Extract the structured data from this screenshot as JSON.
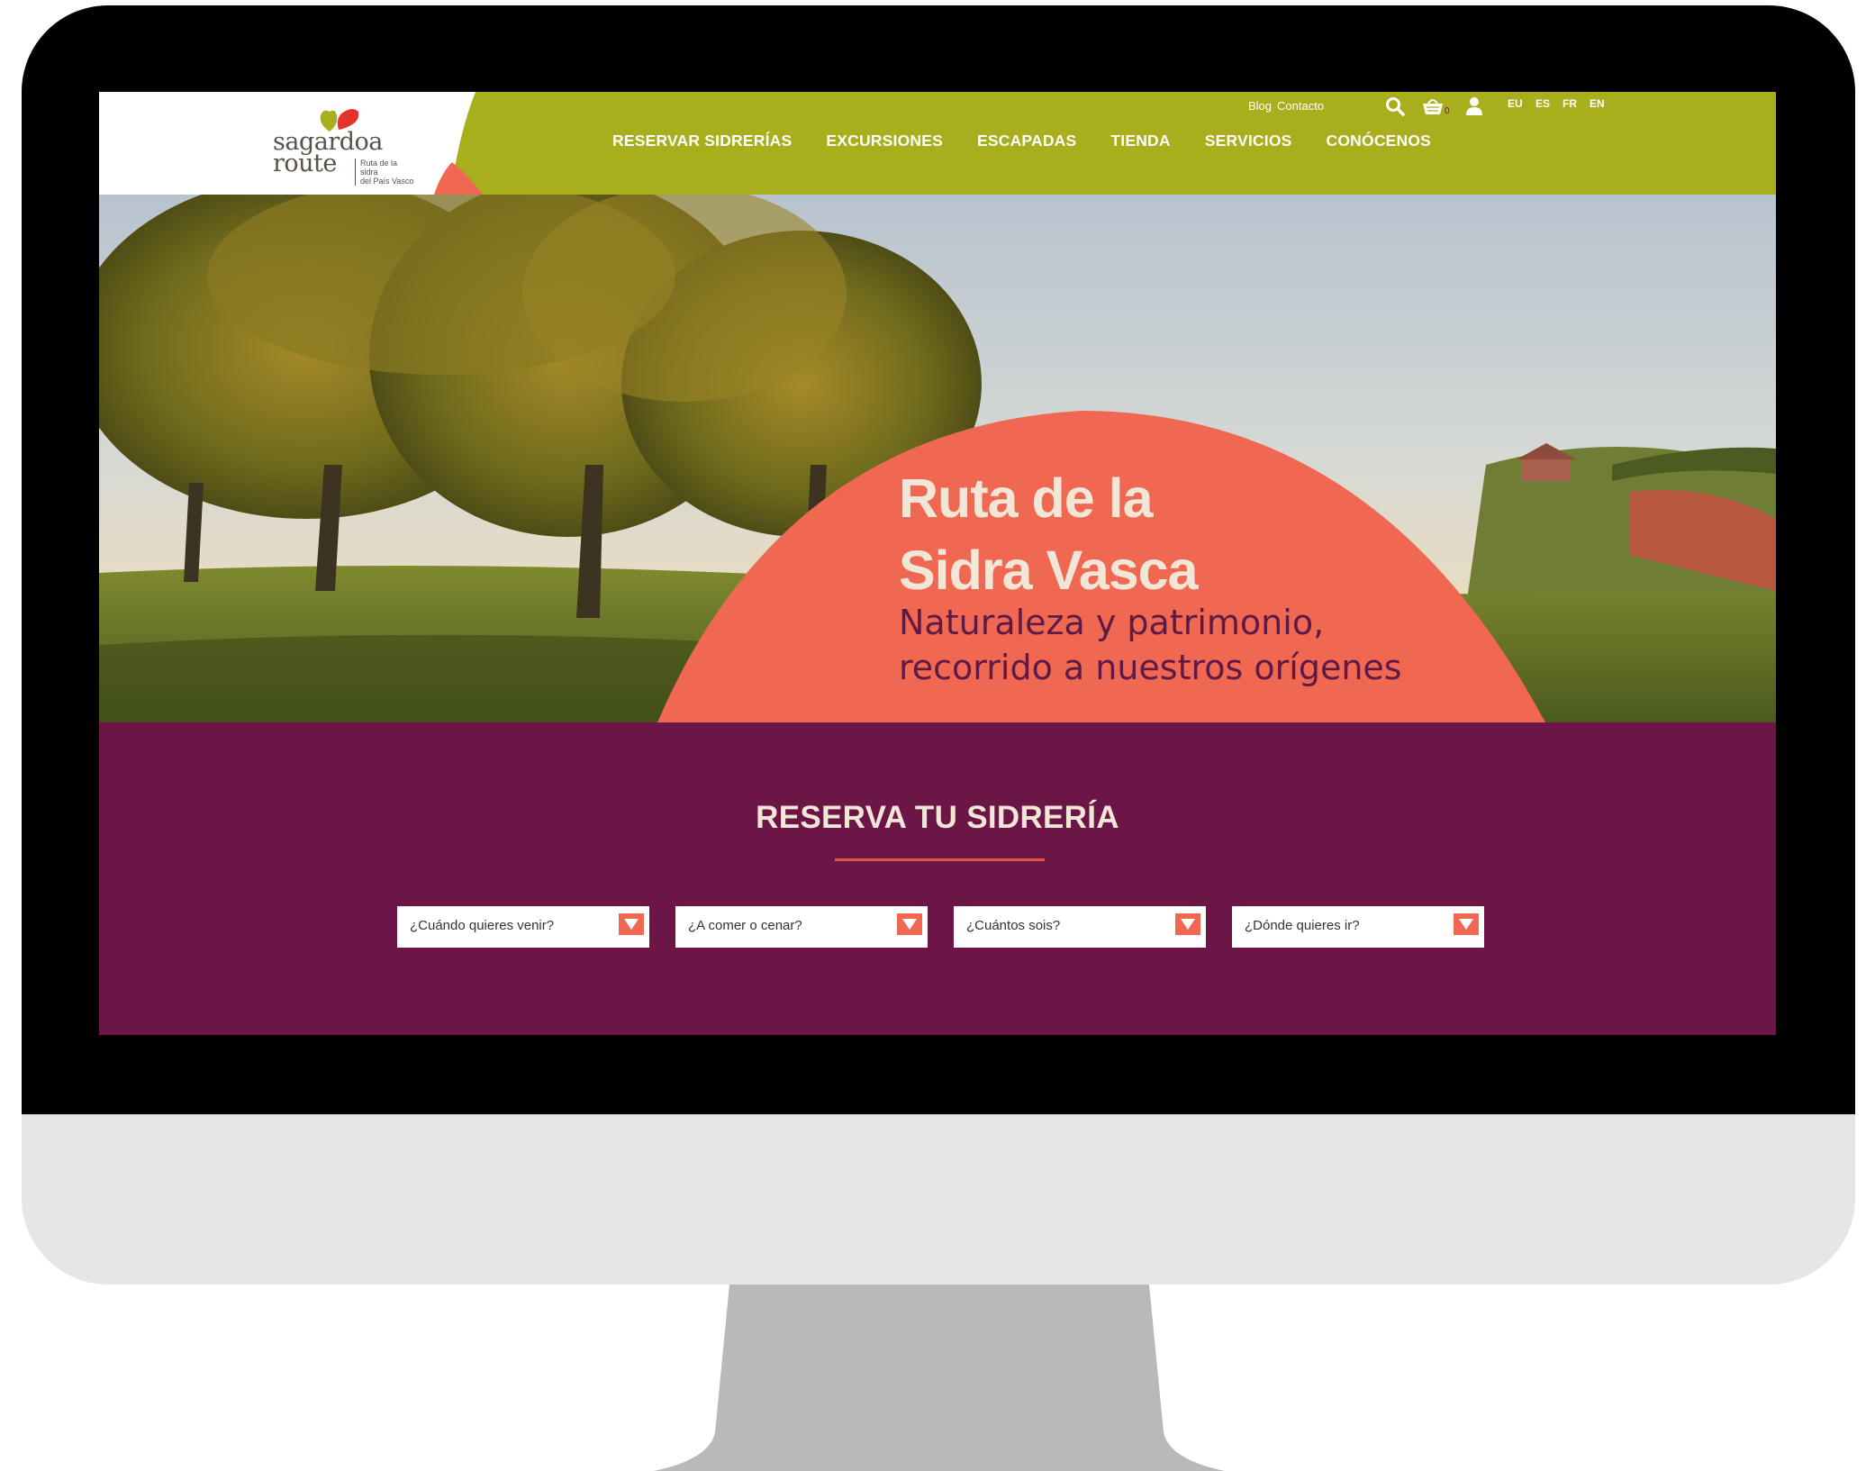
{
  "logo": {
    "line1": "sagardoa",
    "line2": "route",
    "tagline_1": "Ruta de la sidra",
    "tagline_2": "del País Vasco"
  },
  "top_links": [
    "Blog",
    "Contacto"
  ],
  "icons": {
    "search": "search-icon",
    "cart": "basket-icon",
    "user": "user-icon"
  },
  "cart_count": "0",
  "languages": [
    "EU",
    "ES",
    "FR",
    "EN"
  ],
  "nav": [
    "RESERVAR SIDRERÍAS",
    "EXCURSIONES",
    "ESCAPADAS",
    "TIENDA",
    "SERVICIOS",
    "CONÓCENOS"
  ],
  "hero": {
    "title_line1": "Ruta de la",
    "title_line2": "Sidra Vasca",
    "subtitle_line1": "Naturaleza y patrimonio,",
    "subtitle_line2": "recorrido a nuestros orígenes"
  },
  "booking": {
    "title": "RESERVA TU SIDRERÍA",
    "selects": [
      "¿Cuándo quieres venir?",
      "¿A comer o cenar?",
      "¿Cuántos sois?",
      "¿Dónde quieres ir?"
    ]
  },
  "colors": {
    "header": "#a9ae1c",
    "accent": "#f16852",
    "booking_bg": "#6c1547",
    "title_text": "#f2e6d6",
    "subtitle_text": "#5e1a45"
  }
}
